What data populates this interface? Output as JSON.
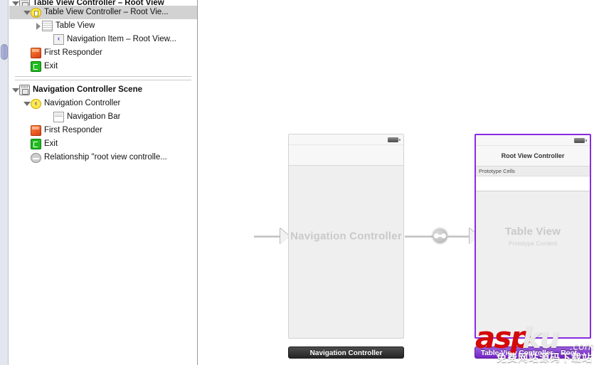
{
  "outline": {
    "rows": [
      {
        "label": "Table View Controller – Root View",
        "icon": "scene-icon",
        "indent": 1,
        "twisty": "down",
        "bold": true,
        "selected": false,
        "clipped": true
      },
      {
        "label": "Table View Controller – Root Vie...",
        "icon": "view-controller-icon",
        "indent": 2,
        "twisty": "down",
        "bold": false,
        "selected": true,
        "clipped": false
      },
      {
        "label": "Table View",
        "icon": "table-view-icon",
        "indent": 3,
        "twisty": "right",
        "bold": false,
        "selected": false,
        "clipped": false
      },
      {
        "label": "Navigation Item – Root View...",
        "icon": "navigation-item-icon",
        "indent": 4,
        "twisty": "none",
        "bold": false,
        "selected": false,
        "clipped": false
      },
      {
        "label": "First Responder",
        "icon": "first-responder-icon",
        "indent": 2,
        "twisty": "none",
        "bold": false,
        "selected": false,
        "clipped": false
      },
      {
        "label": "Exit",
        "icon": "exit-icon",
        "indent": 2,
        "twisty": "none",
        "bold": false,
        "selected": false,
        "clipped": false
      },
      {
        "label": "Navigation Controller Scene",
        "icon": "scene-icon",
        "indent": 1,
        "twisty": "down",
        "bold": true,
        "selected": false,
        "clipped": false
      },
      {
        "label": "Navigation Controller",
        "icon": "navigation-controller-icon",
        "indent": 2,
        "twisty": "down",
        "bold": false,
        "selected": false,
        "clipped": false
      },
      {
        "label": "Navigation Bar",
        "icon": "navigation-bar-icon",
        "indent": 4,
        "twisty": "none",
        "bold": false,
        "selected": false,
        "clipped": false
      },
      {
        "label": "First Responder",
        "icon": "first-responder-icon",
        "indent": 2,
        "twisty": "none",
        "bold": false,
        "selected": false,
        "clipped": false
      },
      {
        "label": "Exit",
        "icon": "exit-icon",
        "indent": 2,
        "twisty": "none",
        "bold": false,
        "selected": false,
        "clipped": false
      },
      {
        "label": "Relationship \"root view controlle...",
        "icon": "relationship-icon",
        "indent": 2,
        "twisty": "none",
        "bold": false,
        "selected": false,
        "clipped": false
      }
    ]
  },
  "canvas": {
    "nav_scene": {
      "center_title": "Navigation Controller",
      "plaque_label": "Navigation Controller"
    },
    "table_scene": {
      "navbar_title": "Root View Controller",
      "prototype_header": "Prototype Cells",
      "center_title": "Table View",
      "center_subtitle": "Prototype Content",
      "plaque_label": "Table View Controller – Root ...",
      "selection_color": "#8a2be2"
    }
  },
  "watermark": {
    "asp": "asp",
    "ku": "ku",
    "com": ".com",
    "chinese": "免费网站源码下载站"
  }
}
